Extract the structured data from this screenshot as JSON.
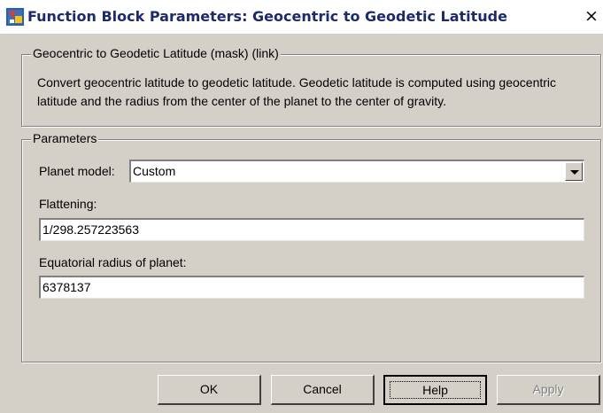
{
  "window": {
    "title": "Function Block Parameters: Geocentric to  Geodetic Latitude",
    "close_glyph": "×"
  },
  "description_group": {
    "legend": "Geocentric to Geodetic Latitude (mask) (link)",
    "text": "Convert geocentric latitude to geodetic latitude.  Geodetic latitude is computed using geocentric latitude and the radius from the center of the planet to the center of gravity."
  },
  "parameters_group": {
    "legend": "Parameters",
    "planet_model": {
      "label": "Planet model:",
      "value": "Custom"
    },
    "flattening": {
      "label": "Flattening:",
      "value": "1/298.257223563"
    },
    "equatorial_radius": {
      "label": "Equatorial radius of planet:",
      "value": "6378137"
    }
  },
  "buttons": {
    "ok": "OK",
    "cancel": "Cancel",
    "help": "Help",
    "apply": "Apply"
  },
  "icons": {
    "app": "simulink-block-icon",
    "close": "close-icon",
    "dropdown": "chevron-down-icon"
  }
}
